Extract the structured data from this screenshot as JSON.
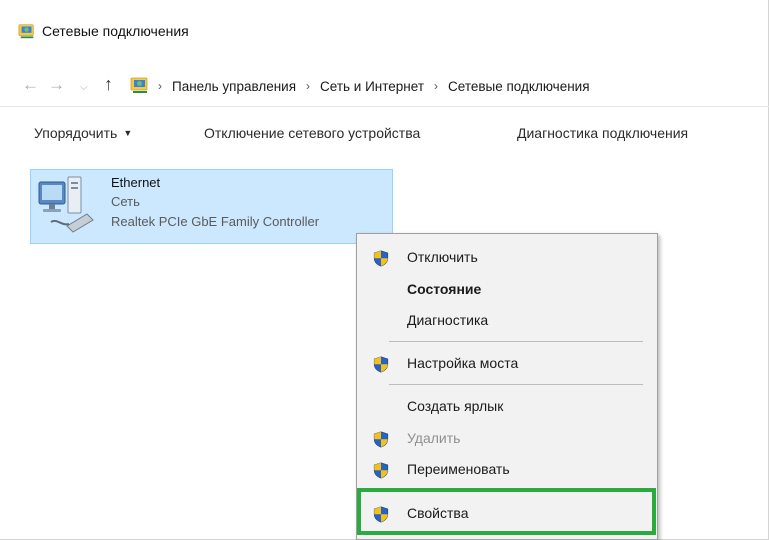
{
  "window": {
    "title": "Сетевые подключения"
  },
  "address": {
    "crumbs": [
      "Панель управления",
      "Сеть и Интернет",
      "Сетевые подключения"
    ],
    "separator": "›"
  },
  "toolbar": {
    "sort_label": "Упорядочить",
    "disconnect_label": "Отключение сетевого устройства",
    "diagnose_label": "Диагностика подключения"
  },
  "connection": {
    "name": "Ethernet",
    "network": "Сеть",
    "adapter": "Realtek PCIe GbE Family Controller",
    "icon": "network-adapter-icon"
  },
  "context_menu": {
    "items": [
      {
        "label": "Отключить",
        "icon": "uac-shield-icon"
      },
      {
        "label": "Состояние",
        "bold": true
      },
      {
        "label": "Диагностика"
      },
      {
        "label": "Настройка моста",
        "icon": "uac-shield-icon"
      },
      {
        "label": "Создать ярлык"
      },
      {
        "label": "Удалить",
        "icon": "uac-shield-icon",
        "disabled": true
      },
      {
        "label": "Переименовать",
        "icon": "uac-shield-icon"
      },
      {
        "label": "Свойства",
        "icon": "uac-shield-icon",
        "highlighted": true
      }
    ]
  },
  "colors": {
    "selection_bg": "#cce8ff",
    "selection_border": "#99d1ff",
    "highlight_frame": "#2aaa3f",
    "menu_bg": "#f2f2f2"
  }
}
